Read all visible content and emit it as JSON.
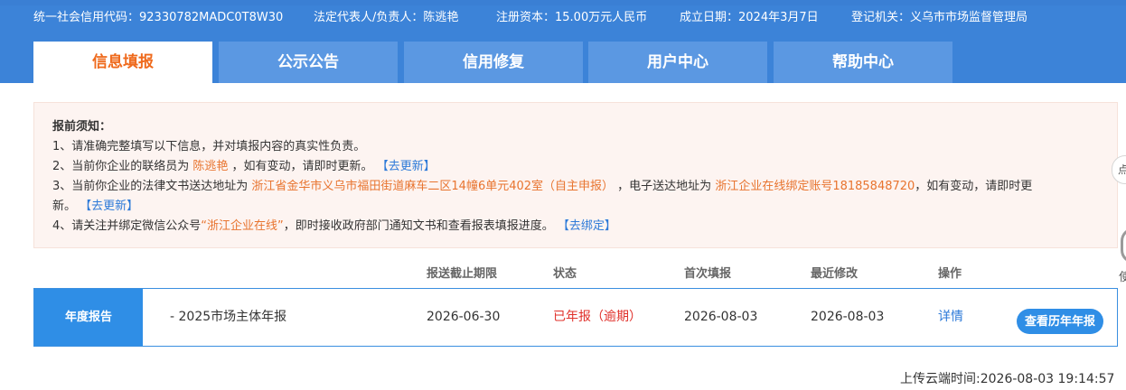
{
  "company_info": {
    "credit_code": "统一社会信用代码：92330782MADC0T8W30",
    "legal_rep": "法定代表人/负责人：陈逃艳",
    "capital": "注册资本：15.00万元人民币",
    "founded": "成立日期：2024年3月7日",
    "authority": "登记机关：义乌市市场监督管理局"
  },
  "tabs": [
    {
      "label": "信息填报"
    },
    {
      "label": "公示公告"
    },
    {
      "label": "信用修复"
    },
    {
      "label": "用户中心"
    },
    {
      "label": "帮助中心"
    }
  ],
  "notice": {
    "title": "报前须知：",
    "line1": "1、请准确完整填写以下信息，并对填报内容的真实性负责。",
    "line2_pre": "2、当前你企业的联络员为 ",
    "line2_name": "陈逃艳",
    "line2_post": " ，如有变动，请即时更新。",
    "line2_link": "【去更新】",
    "line3_pre": "3、当前你企业的法律文书送达地址为 ",
    "line3_addr": "浙江省金华市义乌市福田街道麻车二区14幢6单元402室（自主申报）",
    "line3_mid": " ，电子送达地址为 ",
    "line3_account": "浙江企业在线绑定账号18185848720",
    "line3_post": "，如有变动，请即时更",
    "line3b_pre": "新。",
    "line3b_link": "【去更新】",
    "line4_pre": "4、请关注并绑定微信公众号",
    "line4_name": "“浙江企业在线”",
    "line4_post": "，即时接收政府部门通知文书和查看报表填报进度。",
    "line4_link": "【去绑定】"
  },
  "side": {
    "btn1": "点",
    "label": "使"
  },
  "table": {
    "headers": {
      "deadline": "报送截止期限",
      "status": "状态",
      "first": "首次填报",
      "modified": "最近修改",
      "action": "操作"
    },
    "row": {
      "label": "年度报告",
      "name": "- 2025市场主体年报",
      "deadline": "2026-06-30",
      "status": "已年报（逾期）",
      "first": "2026-08-03",
      "modified": "2026-08-03",
      "detail": "详情",
      "history": "查看历年年报"
    }
  },
  "upload_time": "上传云端时间:2026-08-03 19:14:57",
  "colors": {
    "header": "#3c83d8",
    "tab": "#5b98e2",
    "active_tab_text": "#ef6a1c",
    "accent_blue": "#2f8ee6",
    "highlight_orange": "#e8742f",
    "status_red": "#e0302a",
    "notice_bg": "#fdf4f1"
  }
}
